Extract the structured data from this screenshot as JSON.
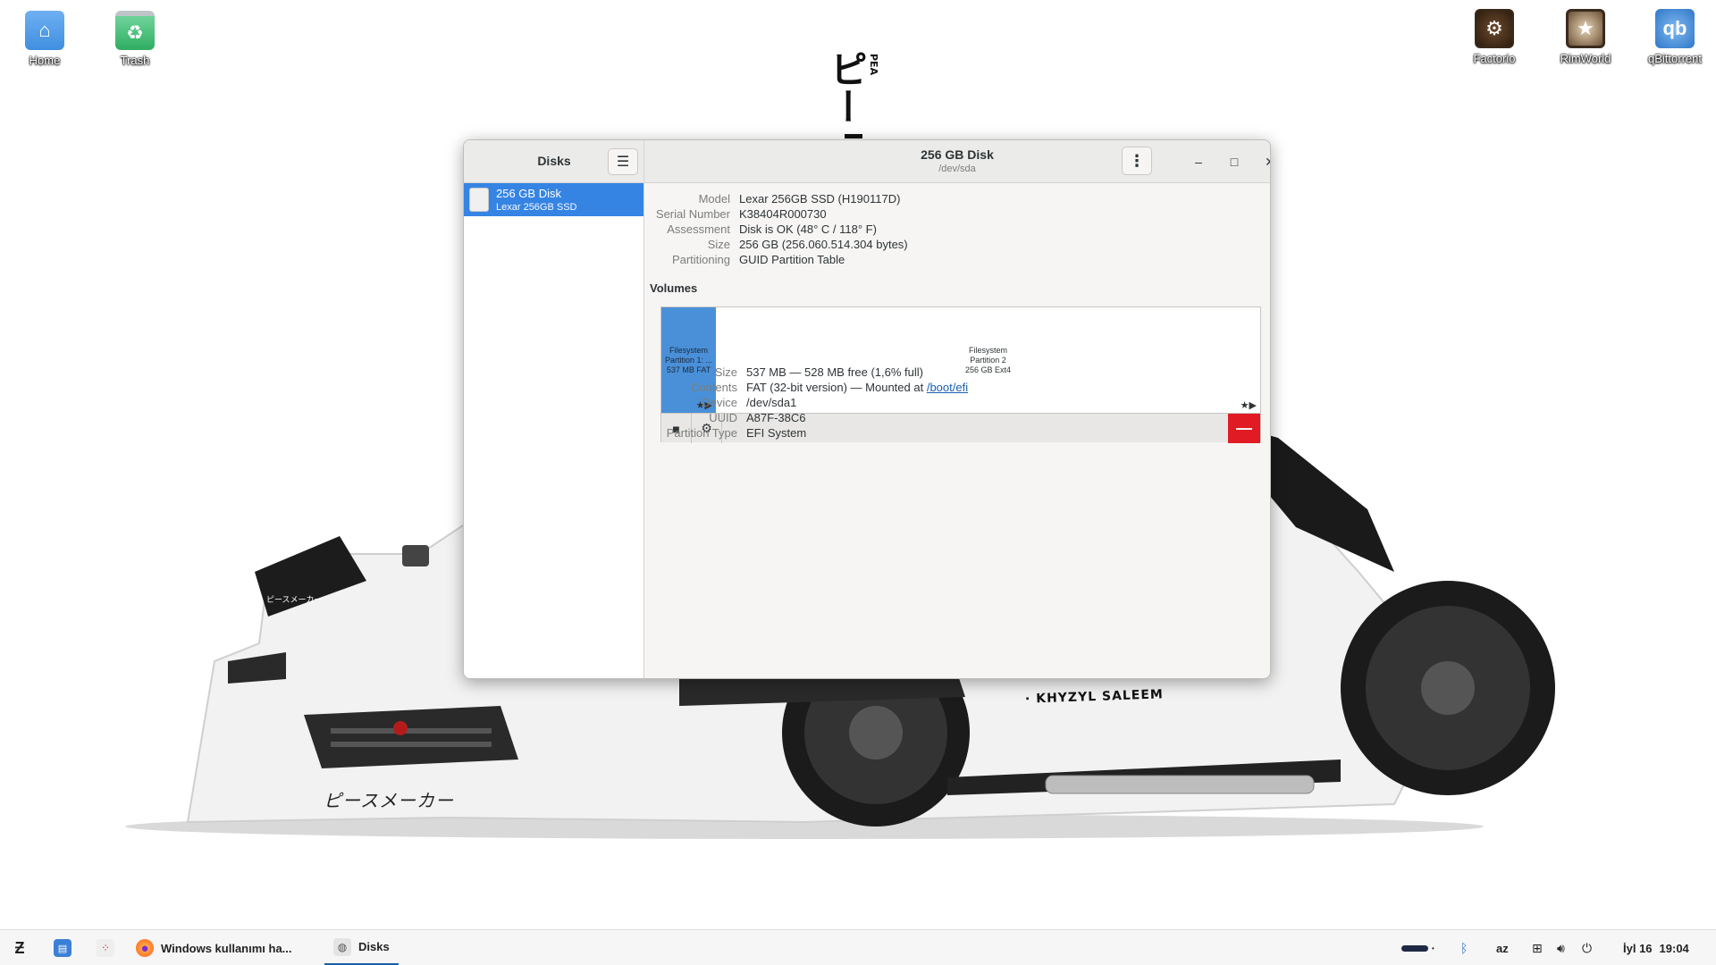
{
  "desktop": {
    "icons_left": [
      {
        "label": "Home",
        "icon": "folder-home-icon"
      },
      {
        "label": "Trash",
        "icon": "trash-icon"
      }
    ],
    "icons_right": [
      {
        "label": "Factorio",
        "icon": "factorio-icon"
      },
      {
        "label": "RimWorld",
        "icon": "rimworld-icon"
      },
      {
        "label": "qBittorrent",
        "icon": "qbittorrent-icon",
        "glyph": "qb"
      }
    ],
    "wallpaper": {
      "poster_kana": "ピー",
      "poster_letters": "PEA",
      "car_small_text": "ピースメーカー",
      "car_big_text": "ピースメーカー",
      "car_name": "· KHYZYL SALEEM"
    }
  },
  "window": {
    "sidebar": {
      "title": "Disks",
      "selected_disk": {
        "name": "256 GB Disk",
        "subtitle": "Lexar 256GB SSD"
      }
    },
    "header": {
      "title": "256 GB Disk",
      "subtitle": "/dev/sda"
    },
    "disk_props": [
      {
        "key": "Model",
        "value": "Lexar 256GB SSD (H190117D)"
      },
      {
        "key": "Serial Number",
        "value": "K38404R000730"
      },
      {
        "key": "Assessment",
        "value": "Disk is OK (48° C / 118° F)"
      },
      {
        "key": "Size",
        "value": "256 GB (256.060.514.304 bytes)"
      },
      {
        "key": "Partitioning",
        "value": "GUID Partition Table"
      }
    ],
    "volumes_label": "Volumes",
    "partitions": [
      {
        "line1": "Filesystem",
        "line2": "Partition 1: ...",
        "line3": "537 MB FAT",
        "selected": true
      },
      {
        "line1": "Filesystem",
        "line2": "Partition 2",
        "line3": "256 GB Ext4",
        "selected": false
      }
    ],
    "partition_mark": "★▶",
    "partition_props": {
      "size_key": "Size",
      "size_value": "537 MB — 528 MB free (1,6% full)",
      "contents_key": "Contents",
      "contents_value": "FAT (32-bit version) — Mounted at ",
      "contents_link": "/boot/efi",
      "device_key": "Device",
      "device_value": "/dev/sda1",
      "uuid_key": "UUID",
      "uuid_value": "A87F-38C6",
      "type_key": "Partition Type",
      "type_value": "EFI System"
    },
    "controls": {
      "minimize": "–",
      "maximize": "□",
      "close": "✕"
    }
  },
  "taskbar": {
    "apps": [
      {
        "label": "Windows kullanımı ha...",
        "icon": "firefox-icon"
      },
      {
        "label": "Disks",
        "icon": "disks-icon",
        "active": true
      }
    ],
    "tray": {
      "keyboard_layout": "az",
      "date": "İyl 16",
      "time": "19:04"
    }
  },
  "colors": {
    "accent": "#3584e4",
    "partition_selected": "#4a90d9",
    "destructive": "#e01b24",
    "link": "#1a5fb4"
  }
}
